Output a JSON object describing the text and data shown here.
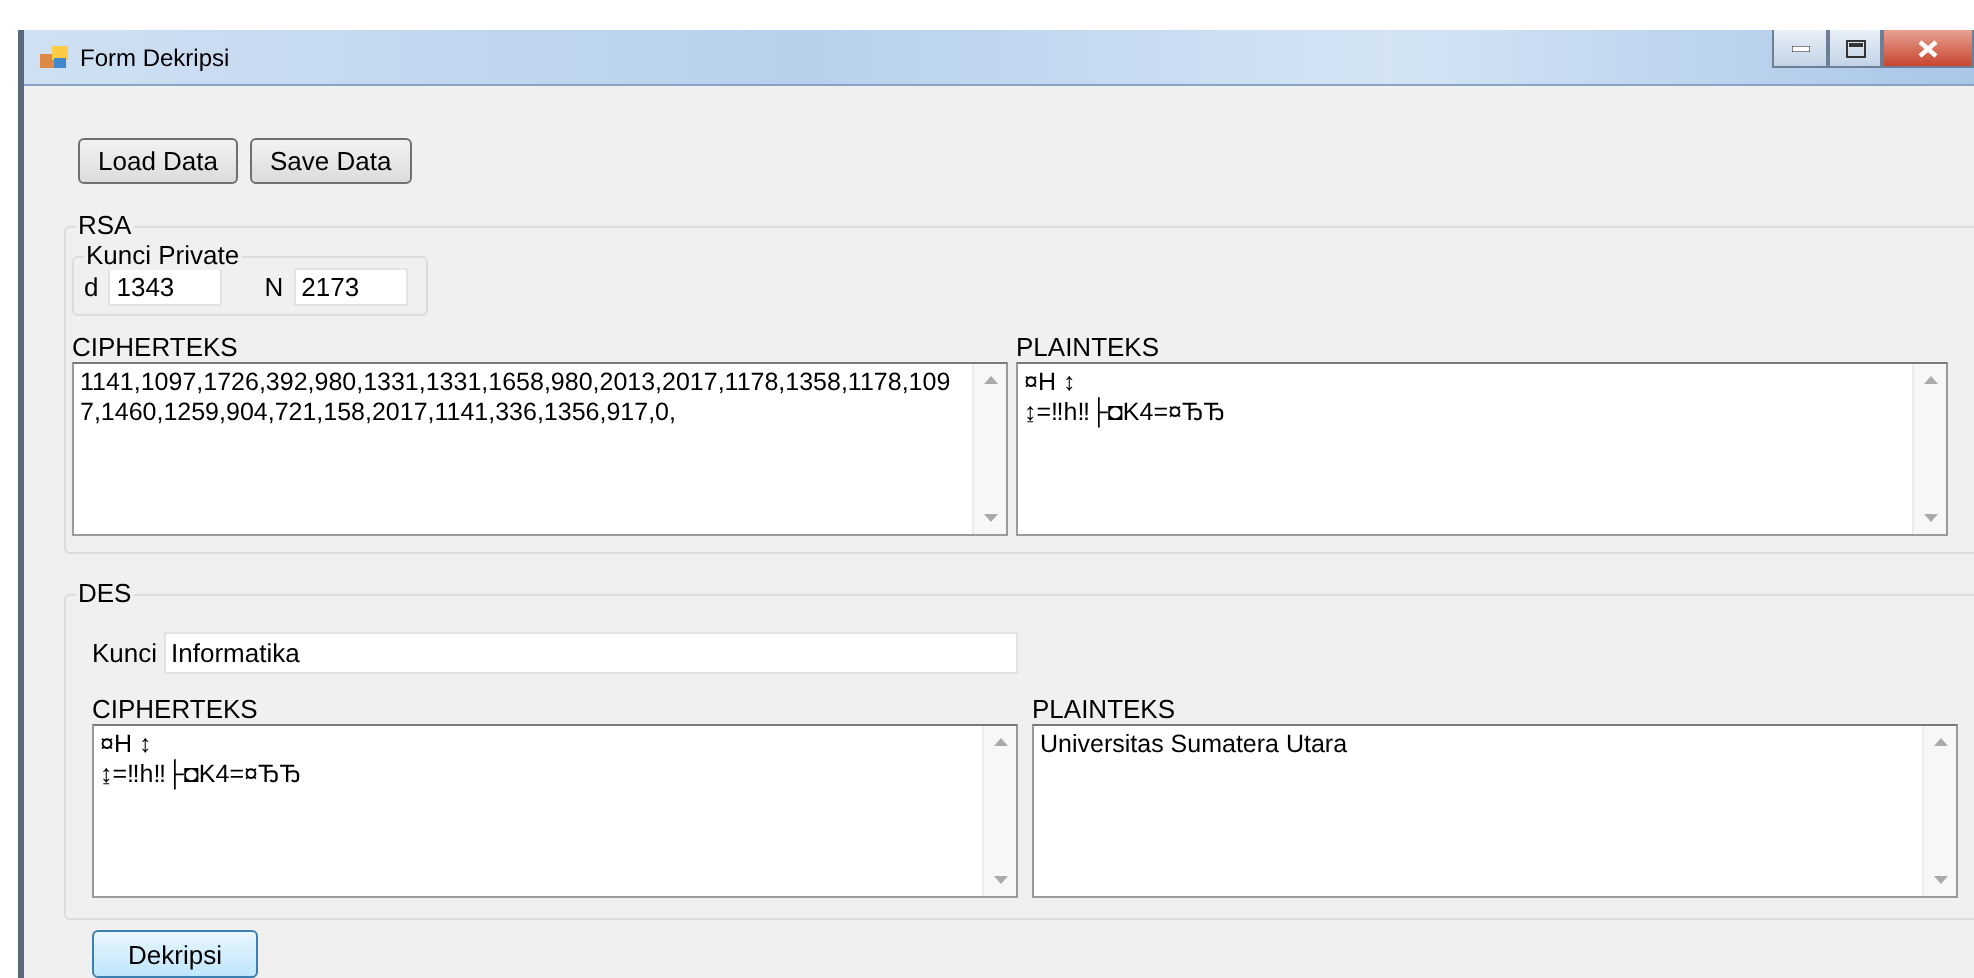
{
  "window": {
    "title": "Form Dekripsi"
  },
  "toolbar": {
    "buttons": [
      "Load Data",
      "Save Data"
    ]
  },
  "rsa": {
    "title": "RSA",
    "private_key": {
      "title": "Kunci Private",
      "fields": [
        {
          "label": "d",
          "value": "1343"
        },
        {
          "label": "N",
          "value": "2173"
        }
      ]
    },
    "ciphertext": {
      "label": "CIPHERTEKS",
      "value": "1141,1097,1726,392,980,1331,1331,1658,980,2013,2017,1178,1358,1178,1097,1460,1259,904,721,158,2017,1141,336,1356,917,0,"
    },
    "plaintext": {
      "label": "PLAINTEKS",
      "value": "¤H ↕\n↨=‼h‼├◘K4=¤ЂЂ"
    }
  },
  "des": {
    "title": "DES",
    "key": {
      "label": "Kunci",
      "value": "Informatika"
    },
    "ciphertext": {
      "label": "CIPHERTEKS",
      "value": "¤H ↕\n↨=‼h‼├◘K4=¤ЂЂ"
    },
    "plaintext": {
      "label": "PLAINTEKS",
      "value": "Universitas Sumatera Utara"
    }
  },
  "action_button": "Dekripsi"
}
